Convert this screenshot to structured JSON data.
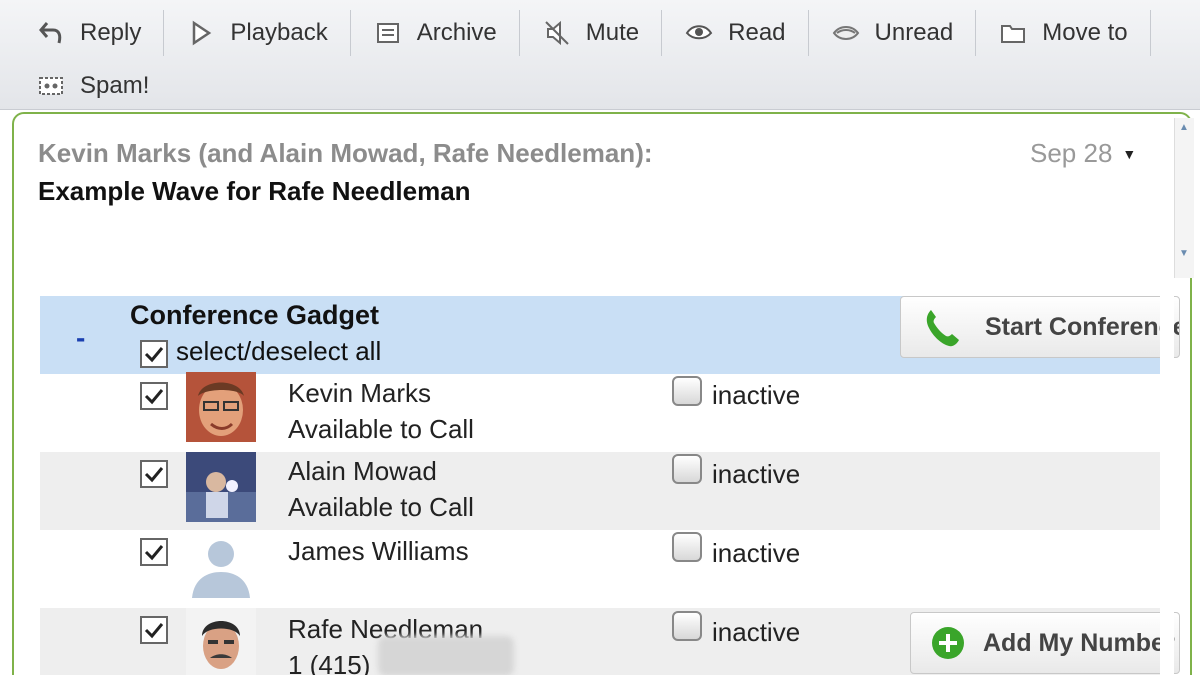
{
  "toolbar": {
    "row1": [
      {
        "label": "Reply",
        "icon": "reply-icon"
      },
      {
        "label": "Playback",
        "icon": "playback-icon"
      },
      {
        "label": "Archive",
        "icon": "archive-icon"
      },
      {
        "label": "Mute",
        "icon": "mute-icon"
      },
      {
        "label": "Read",
        "icon": "eye-icon"
      },
      {
        "label": "Unread",
        "icon": "unread-icon"
      },
      {
        "label": "Move to",
        "icon": "folder-icon"
      }
    ],
    "row2": [
      {
        "label": "Spam!",
        "icon": "spam-icon"
      }
    ]
  },
  "wave": {
    "participants_line": "Kevin Marks (and Alain Mowad, Rafe Needleman):",
    "title": "Example Wave for Rafe Needleman",
    "date": "Sep 28"
  },
  "gadget": {
    "collapse_symbol": "-",
    "title": "Conference Gadget",
    "select_all_label": "select/deselect all",
    "select_all_checked": true,
    "start_button_label": "Start Conference",
    "add_number_button_label": "Add My Number",
    "participants": [
      {
        "name": "Kevin Marks",
        "status": "Available to Call",
        "checked": true,
        "state": "inactive",
        "avatar": "kevin-photo"
      },
      {
        "name": "Alain Mowad",
        "status": "Available to Call",
        "checked": true,
        "state": "inactive",
        "avatar": "alain-photo"
      },
      {
        "name": "James Williams",
        "status": "",
        "checked": true,
        "state": "inactive",
        "avatar": "default-avatar"
      },
      {
        "name": "Rafe Needleman",
        "status": "1 (415)",
        "checked": true,
        "state": "inactive",
        "avatar": "rafe-photo"
      }
    ]
  },
  "colors": {
    "wave_border": "#7fb24a",
    "gadget_header_bg": "#c9dff5",
    "phone_green": "#3aa52a"
  }
}
